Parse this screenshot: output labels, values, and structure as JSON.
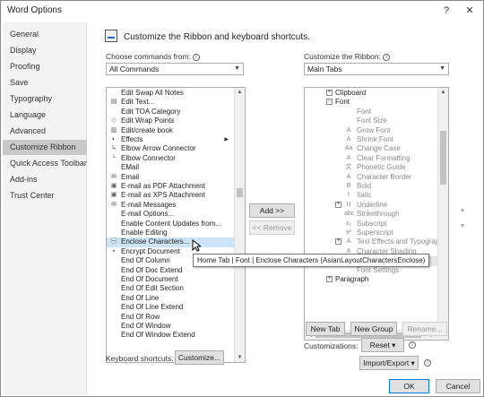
{
  "window": {
    "title": "Word Options",
    "help_label": "?",
    "close_label": "✕"
  },
  "nav": {
    "items": [
      {
        "label": "General",
        "active": false
      },
      {
        "label": "Display",
        "active": false
      },
      {
        "label": "Proofing",
        "active": false
      },
      {
        "label": "Save",
        "active": false
      },
      {
        "label": "Typography",
        "active": false
      },
      {
        "label": "Language",
        "active": false
      },
      {
        "label": "Advanced",
        "active": false
      },
      {
        "label": "Customize Ribbon",
        "active": true
      },
      {
        "label": "Quick Access Toolbar",
        "active": false
      },
      {
        "label": "Add-ins",
        "active": false
      },
      {
        "label": "Trust Center",
        "active": false
      }
    ]
  },
  "header": {
    "text": "Customize the Ribbon and keyboard shortcuts."
  },
  "left": {
    "choose_label": "Choose commands from:",
    "choose_value": "All Commands",
    "commands": [
      {
        "label": "Edit Swap All Notes",
        "icon": "",
        "selected": false,
        "sub": false
      },
      {
        "label": "Edit Text...",
        "icon": "document-icon",
        "selected": false,
        "sub": false
      },
      {
        "label": "Edit TOA Category",
        "icon": "",
        "selected": false,
        "sub": false
      },
      {
        "label": "Edit Wrap Points",
        "icon": "wrap-points-icon",
        "selected": false,
        "sub": false
      },
      {
        "label": "Edit/create book",
        "icon": "book-icon",
        "selected": false,
        "sub": false
      },
      {
        "label": "Effects",
        "icon": "effects-icon",
        "selected": false,
        "sub": true
      },
      {
        "label": "Elbow Arrow Connector",
        "icon": "elbow-arrow-icon",
        "selected": false,
        "sub": false
      },
      {
        "label": "Elbow Connector",
        "icon": "elbow-connector-icon",
        "selected": false,
        "sub": false
      },
      {
        "label": "EMail",
        "icon": "",
        "selected": false,
        "sub": false
      },
      {
        "label": "Email",
        "icon": "email-icon",
        "selected": false,
        "sub": false
      },
      {
        "label": "E-mail as PDF Attachment",
        "icon": "pdf-icon",
        "selected": false,
        "sub": false
      },
      {
        "label": "E-mail as XPS Attachment",
        "icon": "xps-icon",
        "selected": false,
        "sub": false
      },
      {
        "label": "E-mail Messages",
        "icon": "email-icon",
        "selected": false,
        "sub": false
      },
      {
        "label": "E-mail Options...",
        "icon": "",
        "selected": false,
        "sub": false
      },
      {
        "label": "Enable Content Updates from...",
        "icon": "",
        "selected": false,
        "sub": false
      },
      {
        "label": "Enable Editing",
        "icon": "",
        "selected": false,
        "sub": false
      },
      {
        "label": "Enclose Characters...",
        "icon": "enclose-characters-icon",
        "selected": true,
        "sub": false
      },
      {
        "label": "Encrypt Document",
        "icon": "lock-icon",
        "selected": false,
        "sub": false
      },
      {
        "label": "End Of Column",
        "icon": "",
        "selected": false,
        "sub": false
      },
      {
        "label": "End Of Doc Extend",
        "icon": "",
        "selected": false,
        "sub": false
      },
      {
        "label": "End Of Document",
        "icon": "",
        "selected": false,
        "sub": false
      },
      {
        "label": "End Of Edit Section",
        "icon": "",
        "selected": false,
        "sub": false
      },
      {
        "label": "End Of Line",
        "icon": "",
        "selected": false,
        "sub": false
      },
      {
        "label": "End Of Line Extend",
        "icon": "",
        "selected": false,
        "sub": false
      },
      {
        "label": "End Of Row",
        "icon": "",
        "selected": false,
        "sub": false
      },
      {
        "label": "End Of Window",
        "icon": "",
        "selected": false,
        "sub": false
      },
      {
        "label": "End Of Window Extend",
        "icon": "",
        "selected": false,
        "sub": false
      }
    ],
    "keyboard_label": "Keyboard shortcuts:",
    "customize_label": "Customize..."
  },
  "middle": {
    "add_label": "Add >>",
    "remove_label": "<< Remove"
  },
  "right": {
    "customize_label": "Customize the Ribbon:",
    "customize_value": "Main Tabs",
    "tree": [
      {
        "label": "Clipboard",
        "level": 1,
        "expander": "+",
        "icon": "",
        "dim": false,
        "hl": false
      },
      {
        "label": "Font",
        "level": 1,
        "expander": "−",
        "icon": "",
        "dim": false,
        "hl": false
      },
      {
        "label": "Font",
        "level": 2,
        "expander": "",
        "icon": "",
        "dim": true,
        "hl": false
      },
      {
        "label": "Font Size",
        "level": 2,
        "expander": "",
        "icon": "",
        "dim": true,
        "hl": false
      },
      {
        "label": "Grow Font",
        "level": 2,
        "expander": "",
        "icon": "A",
        "dim": true,
        "hl": false
      },
      {
        "label": "Shrink Font",
        "level": 2,
        "expander": "",
        "icon": "A",
        "dim": true,
        "hl": false
      },
      {
        "label": "Change Case",
        "level": 2,
        "expander": "",
        "icon": "Aa",
        "dim": true,
        "hl": false
      },
      {
        "label": "Clear Formatting",
        "level": 2,
        "expander": "",
        "icon": "A",
        "dim": true,
        "hl": false
      },
      {
        "label": "Phonetic Guide",
        "level": 2,
        "expander": "",
        "icon": "文",
        "dim": true,
        "hl": false
      },
      {
        "label": "Character Border",
        "level": 2,
        "expander": "",
        "icon": "A",
        "dim": true,
        "hl": false
      },
      {
        "label": "Bold",
        "level": 2,
        "expander": "",
        "icon": "B",
        "dim": true,
        "hl": false
      },
      {
        "label": "Italic",
        "level": 2,
        "expander": "",
        "icon": "I",
        "dim": true,
        "hl": false
      },
      {
        "label": "Underline",
        "level": 2,
        "expander": "+",
        "icon": "U",
        "dim": true,
        "hl": false
      },
      {
        "label": "Strikethrough",
        "level": 2,
        "expander": "",
        "icon": "abc",
        "dim": true,
        "hl": false
      },
      {
        "label": "Subscript",
        "level": 2,
        "expander": "",
        "icon": "x₂",
        "dim": true,
        "hl": false
      },
      {
        "label": "Superscript",
        "level": 2,
        "expander": "",
        "icon": "x²",
        "dim": true,
        "hl": false
      },
      {
        "label": "Text Effects and Typograp",
        "level": 2,
        "expander": "+",
        "icon": "A",
        "dim": true,
        "hl": false
      },
      {
        "label": "Character Shading",
        "level": 2,
        "expander": "",
        "icon": "A",
        "dim": true,
        "hl": false
      },
      {
        "label": "Enclose Characters",
        "level": 2,
        "expander": "",
        "icon": "字",
        "dim": true,
        "hl": true
      },
      {
        "label": "Font Settings",
        "level": 2,
        "expander": "",
        "icon": "",
        "dim": true,
        "hl": false
      },
      {
        "label": "Paragraph",
        "level": 1,
        "expander": "+",
        "icon": "",
        "dim": false,
        "hl": false
      }
    ],
    "new_tab_label": "New Tab",
    "new_group_label": "New Group",
    "rename_label": "Rename...",
    "customizations_label": "Customizations:",
    "reset_label": "Reset ▾",
    "import_export_label": "Import/Export ▾"
  },
  "tooltip": {
    "text": "Home Tab | Font | Enclose Characters (AsianLayoutCharactersEnclose)"
  },
  "footer": {
    "ok_label": "OK",
    "cancel_label": "Cancel"
  }
}
